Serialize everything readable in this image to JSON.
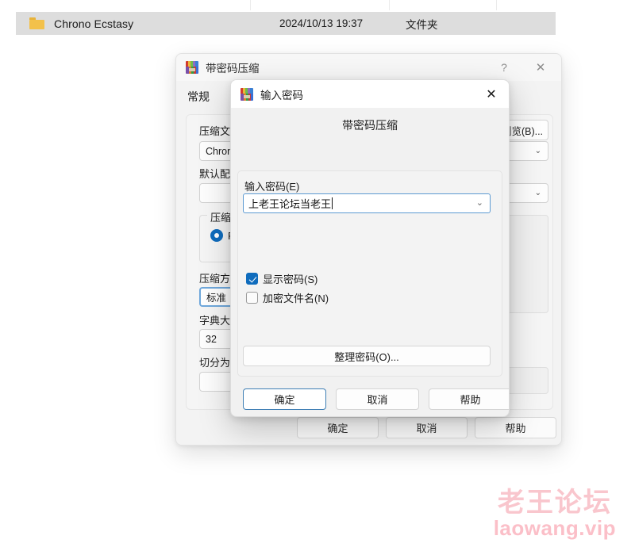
{
  "explorer": {
    "folder_icon": "folder-icon",
    "name": "Chrono Ecstasy",
    "date": "2024/10/13 19:37",
    "type": "文件夹"
  },
  "background_dialog": {
    "icon": "winrar-icon",
    "title": "带密码压缩",
    "help_icon": "?",
    "close_icon": "✕",
    "tab": "常规",
    "fields": {
      "archive_name_label": "压缩文件名(A)",
      "archive_name_value": "Chrono Ecstasy.rar",
      "browse_button": "浏览(B)...",
      "profile_label": "默认配置(F)",
      "profile_value": "",
      "format_group_title": "压缩格式",
      "format_radio": "RAR",
      "method_label": "压缩方式(C)",
      "method_value": "标准",
      "dict_label": "字典大小(D)",
      "dict_value": "32",
      "split_label": "切分为分卷(V), 大小",
      "split_value": ""
    },
    "buttons": {
      "ok": "确定",
      "cancel": "取消",
      "help": "帮助"
    }
  },
  "password_dialog": {
    "icon": "winrar-icon",
    "title": "输入密码",
    "close_icon": "✕",
    "headline": "带密码压缩",
    "password_label": "输入密码(E)",
    "password_value": "上老王论坛当老王",
    "dropdown_icon": "chevron-down-icon",
    "checkboxes": [
      {
        "label": "显示密码(S)",
        "checked": true
      },
      {
        "label": "加密文件名(N)",
        "checked": false
      }
    ],
    "organize_button": "整理密码(O)...",
    "buttons": {
      "ok": "确定",
      "cancel": "取消",
      "help": "帮助"
    }
  },
  "watermark": {
    "cn": "老王论坛",
    "en": "laowang.vip",
    "color": "#f9c6cd"
  }
}
